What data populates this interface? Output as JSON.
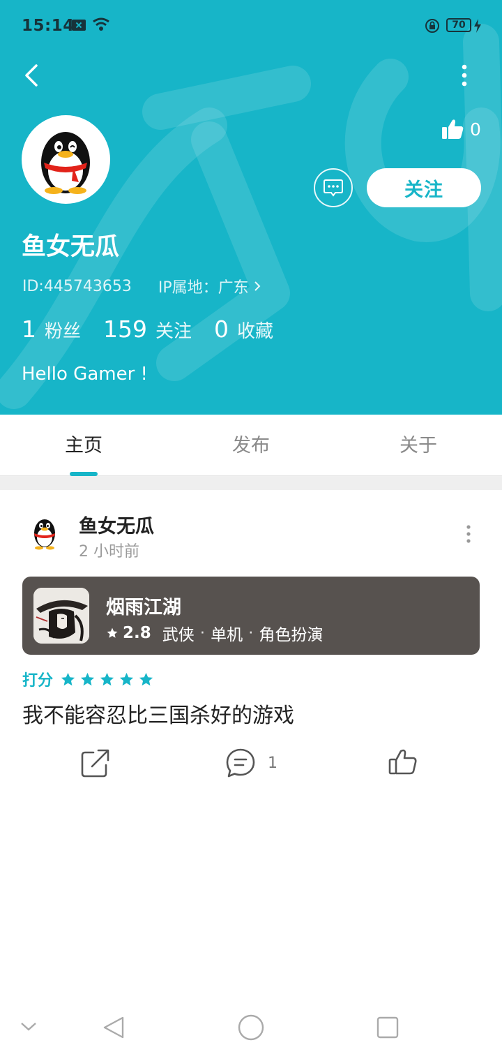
{
  "status_bar": {
    "time": "15:14",
    "battery": "70"
  },
  "profile": {
    "name": "鱼女无瓜",
    "id_text": "ID:445743653",
    "ip_text": "IP属地：广东",
    "likes": "0",
    "follow_label": "关注",
    "bio": "Hello Gamer !",
    "stats": [
      {
        "num": "1",
        "label": "粉丝"
      },
      {
        "num": "159",
        "label": "关注"
      },
      {
        "num": "0",
        "label": "收藏"
      }
    ]
  },
  "tabs": [
    {
      "label": "主页",
      "active": true
    },
    {
      "label": "发布",
      "active": false
    },
    {
      "label": "关于",
      "active": false
    }
  ],
  "post": {
    "author": "鱼女无瓜",
    "time": "2 小时前",
    "game": {
      "title": "烟雨江湖",
      "rating": "2.8",
      "tags": [
        "武侠",
        "单机",
        "角色扮演"
      ]
    },
    "rating_label": "打分",
    "stars": 5,
    "text": "我不能容忍比三国杀好的游戏",
    "comment_count": "1"
  },
  "colors": {
    "accent": "#17b5c8",
    "card_bg": "#57524f"
  },
  "icons": [
    "back-icon",
    "more-icon",
    "thumbs-up-icon",
    "message-icon",
    "chevron-right-icon",
    "star-icon",
    "share-icon",
    "comment-icon",
    "like-icon",
    "nav-back-icon",
    "nav-home-icon",
    "nav-recent-icon",
    "nav-collapse-icon"
  ]
}
